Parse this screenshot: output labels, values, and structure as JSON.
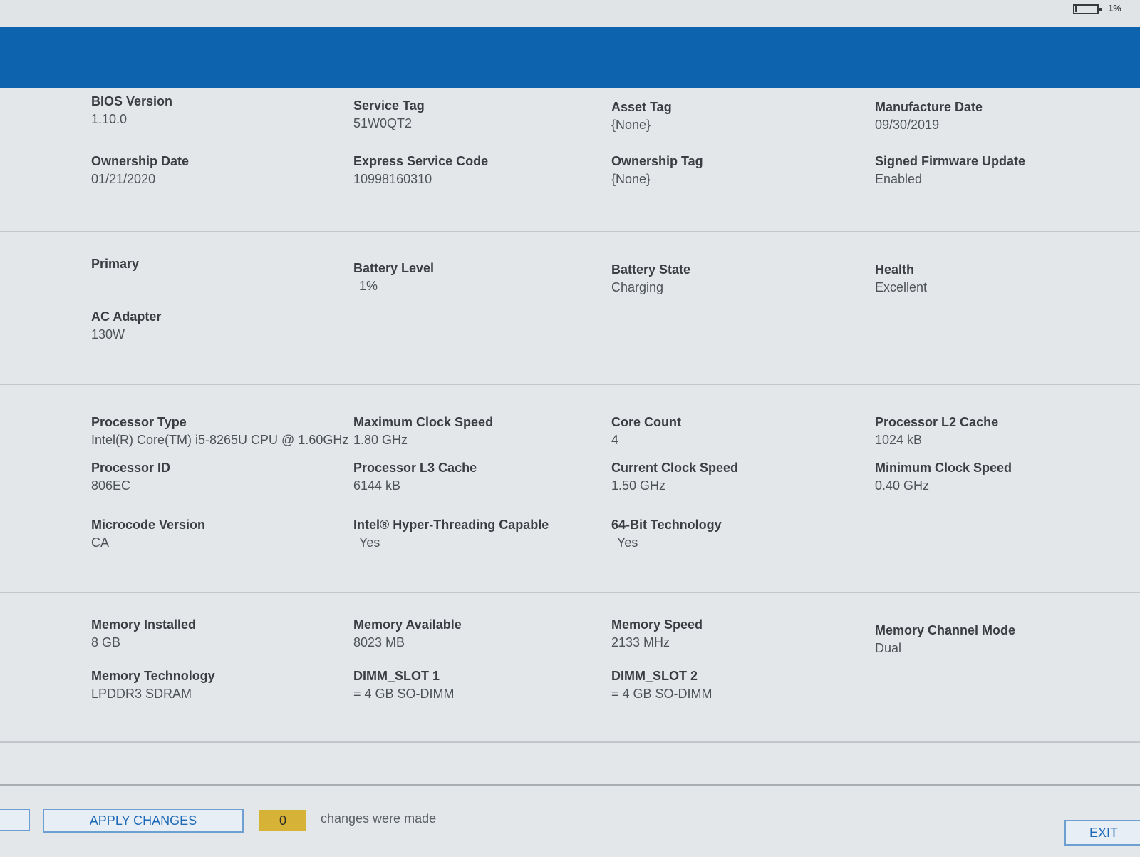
{
  "status": {
    "battery_pct_label": "1%",
    "battery_level_fraction": 0.01
  },
  "colors": {
    "header_band": "#0d63ae",
    "counter_badge": "#d6b336",
    "button_text": "#1c69b5"
  },
  "sections": {
    "system": {
      "bios_version": {
        "label": "BIOS Version",
        "value": "1.10.0"
      },
      "service_tag": {
        "label": "Service Tag",
        "value": "51W0QT2"
      },
      "asset_tag": {
        "label": "Asset Tag",
        "value": "{None}"
      },
      "manufacture_date": {
        "label": "Manufacture Date",
        "value": "09/30/2019"
      },
      "ownership_date": {
        "label": "Ownership Date",
        "value": "01/21/2020"
      },
      "express_service_code": {
        "label": "Express Service Code",
        "value": "10998160310"
      },
      "ownership_tag": {
        "label": "Ownership Tag",
        "value": "{None}"
      },
      "signed_firmware_update": {
        "label": "Signed Firmware Update",
        "value": "Enabled"
      }
    },
    "battery": {
      "primary": {
        "label": "Primary"
      },
      "battery_level": {
        "label": "Battery Level",
        "value": "1%"
      },
      "battery_state": {
        "label": "Battery State",
        "value": "Charging"
      },
      "health": {
        "label": "Health",
        "value": "Excellent"
      },
      "ac_adapter": {
        "label": "AC Adapter",
        "value": "130W"
      }
    },
    "processor": {
      "processor_type": {
        "label": "Processor Type",
        "value": "Intel(R) Core(TM) i5-8265U CPU @ 1.60GHz"
      },
      "max_clock": {
        "label": "Maximum Clock Speed",
        "value": "1.80 GHz"
      },
      "core_count": {
        "label": "Core Count",
        "value": "4"
      },
      "l2_cache": {
        "label": "Processor L2 Cache",
        "value": "1024 kB"
      },
      "processor_id": {
        "label": "Processor ID",
        "value": "806EC"
      },
      "l3_cache": {
        "label": "Processor L3 Cache",
        "value": "6144 kB"
      },
      "current_clock": {
        "label": "Current Clock Speed",
        "value": "1.50 GHz"
      },
      "min_clock": {
        "label": "Minimum Clock Speed",
        "value": "0.40 GHz"
      },
      "microcode": {
        "label": "Microcode Version",
        "value": "CA"
      },
      "hyperthreading": {
        "label": "Intel® Hyper-Threading Capable",
        "value": "Yes"
      },
      "bit64": {
        "label": "64-Bit Technology",
        "value": "Yes"
      }
    },
    "memory": {
      "installed": {
        "label": "Memory Installed",
        "value": "8 GB"
      },
      "available": {
        "label": "Memory Available",
        "value": "8023 MB"
      },
      "speed": {
        "label": "Memory Speed",
        "value": "2133 MHz"
      },
      "channel_mode": {
        "label": "Memory Channel Mode",
        "value": "Dual"
      },
      "technology": {
        "label": "Memory Technology",
        "value": "LPDDR3 SDRAM"
      },
      "dimm1": {
        "label": "DIMM_SLOT 1",
        "value": "= 4 GB SO-DIMM"
      },
      "dimm2": {
        "label": "DIMM_SLOT 2",
        "value": "= 4 GB SO-DIMM"
      }
    }
  },
  "footer": {
    "apply_label": "APPLY CHANGES",
    "changes_count": "0",
    "changes_text": "changes were made",
    "exit_label": "EXIT"
  }
}
